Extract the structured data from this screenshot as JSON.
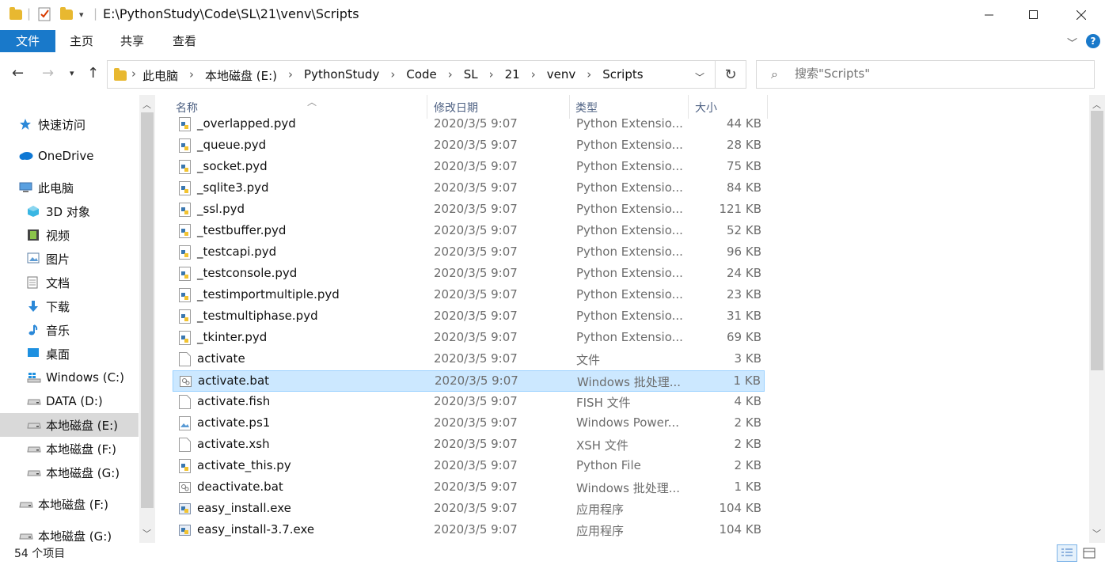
{
  "window": {
    "title": "E:\\PythonStudy\\Code\\SL\\21\\venv\\Scripts",
    "min_icon": "minimize-icon",
    "max_icon": "maximize-icon",
    "close_icon": "close-icon"
  },
  "ribbon": {
    "tabs": [
      {
        "label": "文件"
      },
      {
        "label": "主页"
      },
      {
        "label": "共享"
      },
      {
        "label": "查看"
      }
    ]
  },
  "address": {
    "crumbs": [
      "此电脑",
      "本地磁盘 (E:)",
      "PythonStudy",
      "Code",
      "SL",
      "21",
      "venv",
      "Scripts"
    ],
    "search_placeholder": "搜索\"Scripts\""
  },
  "navpane": {
    "items": [
      {
        "label": "快速访问",
        "icon": "star-icon"
      },
      {
        "label": "OneDrive",
        "icon": "cloud-icon"
      },
      {
        "label": "此电脑",
        "icon": "computer-icon"
      },
      {
        "label": "3D 对象",
        "icon": "cube-icon"
      },
      {
        "label": "视频",
        "icon": "video-icon"
      },
      {
        "label": "图片",
        "icon": "pictures-icon"
      },
      {
        "label": "文档",
        "icon": "document-icon"
      },
      {
        "label": "下载",
        "icon": "download-icon"
      },
      {
        "label": "音乐",
        "icon": "music-icon"
      },
      {
        "label": "桌面",
        "icon": "desktop-icon"
      },
      {
        "label": "Windows (C:)",
        "icon": "windows-drive-icon"
      },
      {
        "label": "DATA (D:)",
        "icon": "drive-icon"
      },
      {
        "label": "本地磁盘 (E:)",
        "icon": "drive-icon"
      },
      {
        "label": "本地磁盘 (F:)",
        "icon": "drive-icon"
      },
      {
        "label": "本地磁盘 (G:)",
        "icon": "drive-icon"
      },
      {
        "label": "本地磁盘 (F:)",
        "icon": "drive-icon"
      },
      {
        "label": "本地磁盘 (G:)",
        "icon": "drive-icon"
      }
    ]
  },
  "columns": {
    "name": "名称",
    "date": "修改日期",
    "type": "类型",
    "size": "大小"
  },
  "files": [
    {
      "name": "_overlapped.pyd",
      "date": "2020/3/5 9:07",
      "type": "Python Extensio...",
      "size": "44 KB",
      "icon": "python-file-icon"
    },
    {
      "name": "_queue.pyd",
      "date": "2020/3/5 9:07",
      "type": "Python Extensio...",
      "size": "28 KB",
      "icon": "python-file-icon"
    },
    {
      "name": "_socket.pyd",
      "date": "2020/3/5 9:07",
      "type": "Python Extensio...",
      "size": "75 KB",
      "icon": "python-file-icon"
    },
    {
      "name": "_sqlite3.pyd",
      "date": "2020/3/5 9:07",
      "type": "Python Extensio...",
      "size": "84 KB",
      "icon": "python-file-icon"
    },
    {
      "name": "_ssl.pyd",
      "date": "2020/3/5 9:07",
      "type": "Python Extensio...",
      "size": "121 KB",
      "icon": "python-file-icon"
    },
    {
      "name": "_testbuffer.pyd",
      "date": "2020/3/5 9:07",
      "type": "Python Extensio...",
      "size": "52 KB",
      "icon": "python-file-icon"
    },
    {
      "name": "_testcapi.pyd",
      "date": "2020/3/5 9:07",
      "type": "Python Extensio...",
      "size": "96 KB",
      "icon": "python-file-icon"
    },
    {
      "name": "_testconsole.pyd",
      "date": "2020/3/5 9:07",
      "type": "Python Extensio...",
      "size": "24 KB",
      "icon": "python-file-icon"
    },
    {
      "name": "_testimportmultiple.pyd",
      "date": "2020/3/5 9:07",
      "type": "Python Extensio...",
      "size": "23 KB",
      "icon": "python-file-icon"
    },
    {
      "name": "_testmultiphase.pyd",
      "date": "2020/3/5 9:07",
      "type": "Python Extensio...",
      "size": "31 KB",
      "icon": "python-file-icon"
    },
    {
      "name": "_tkinter.pyd",
      "date": "2020/3/5 9:07",
      "type": "Python Extensio...",
      "size": "69 KB",
      "icon": "python-file-icon"
    },
    {
      "name": "activate",
      "date": "2020/3/5 9:07",
      "type": "文件",
      "size": "3 KB",
      "icon": "blank-file-icon"
    },
    {
      "name": "activate.bat",
      "date": "2020/3/5 9:07",
      "type": "Windows 批处理...",
      "size": "1 KB",
      "icon": "batch-file-icon",
      "selected": true
    },
    {
      "name": "activate.fish",
      "date": "2020/3/5 9:07",
      "type": "FISH 文件",
      "size": "4 KB",
      "icon": "blank-file-icon"
    },
    {
      "name": "activate.ps1",
      "date": "2020/3/5 9:07",
      "type": "Windows Power...",
      "size": "2 KB",
      "icon": "powershell-file-icon"
    },
    {
      "name": "activate.xsh",
      "date": "2020/3/5 9:07",
      "type": "XSH 文件",
      "size": "2 KB",
      "icon": "blank-file-icon"
    },
    {
      "name": "activate_this.py",
      "date": "2020/3/5 9:07",
      "type": "Python File",
      "size": "2 KB",
      "icon": "python-file-icon"
    },
    {
      "name": "deactivate.bat",
      "date": "2020/3/5 9:07",
      "type": "Windows 批处理...",
      "size": "1 KB",
      "icon": "batch-file-icon"
    },
    {
      "name": "easy_install.exe",
      "date": "2020/3/5 9:07",
      "type": "应用程序",
      "size": "104 KB",
      "icon": "exe-file-icon"
    },
    {
      "name": "easy_install-3.7.exe",
      "date": "2020/3/5 9:07",
      "type": "应用程序",
      "size": "104 KB",
      "icon": "exe-file-icon"
    }
  ],
  "status": {
    "count": "54 个项目"
  },
  "colors": {
    "accent": "#1979ca",
    "selection": "#cce8ff",
    "header_text": "#4d6082",
    "folder": "#e8b830"
  }
}
